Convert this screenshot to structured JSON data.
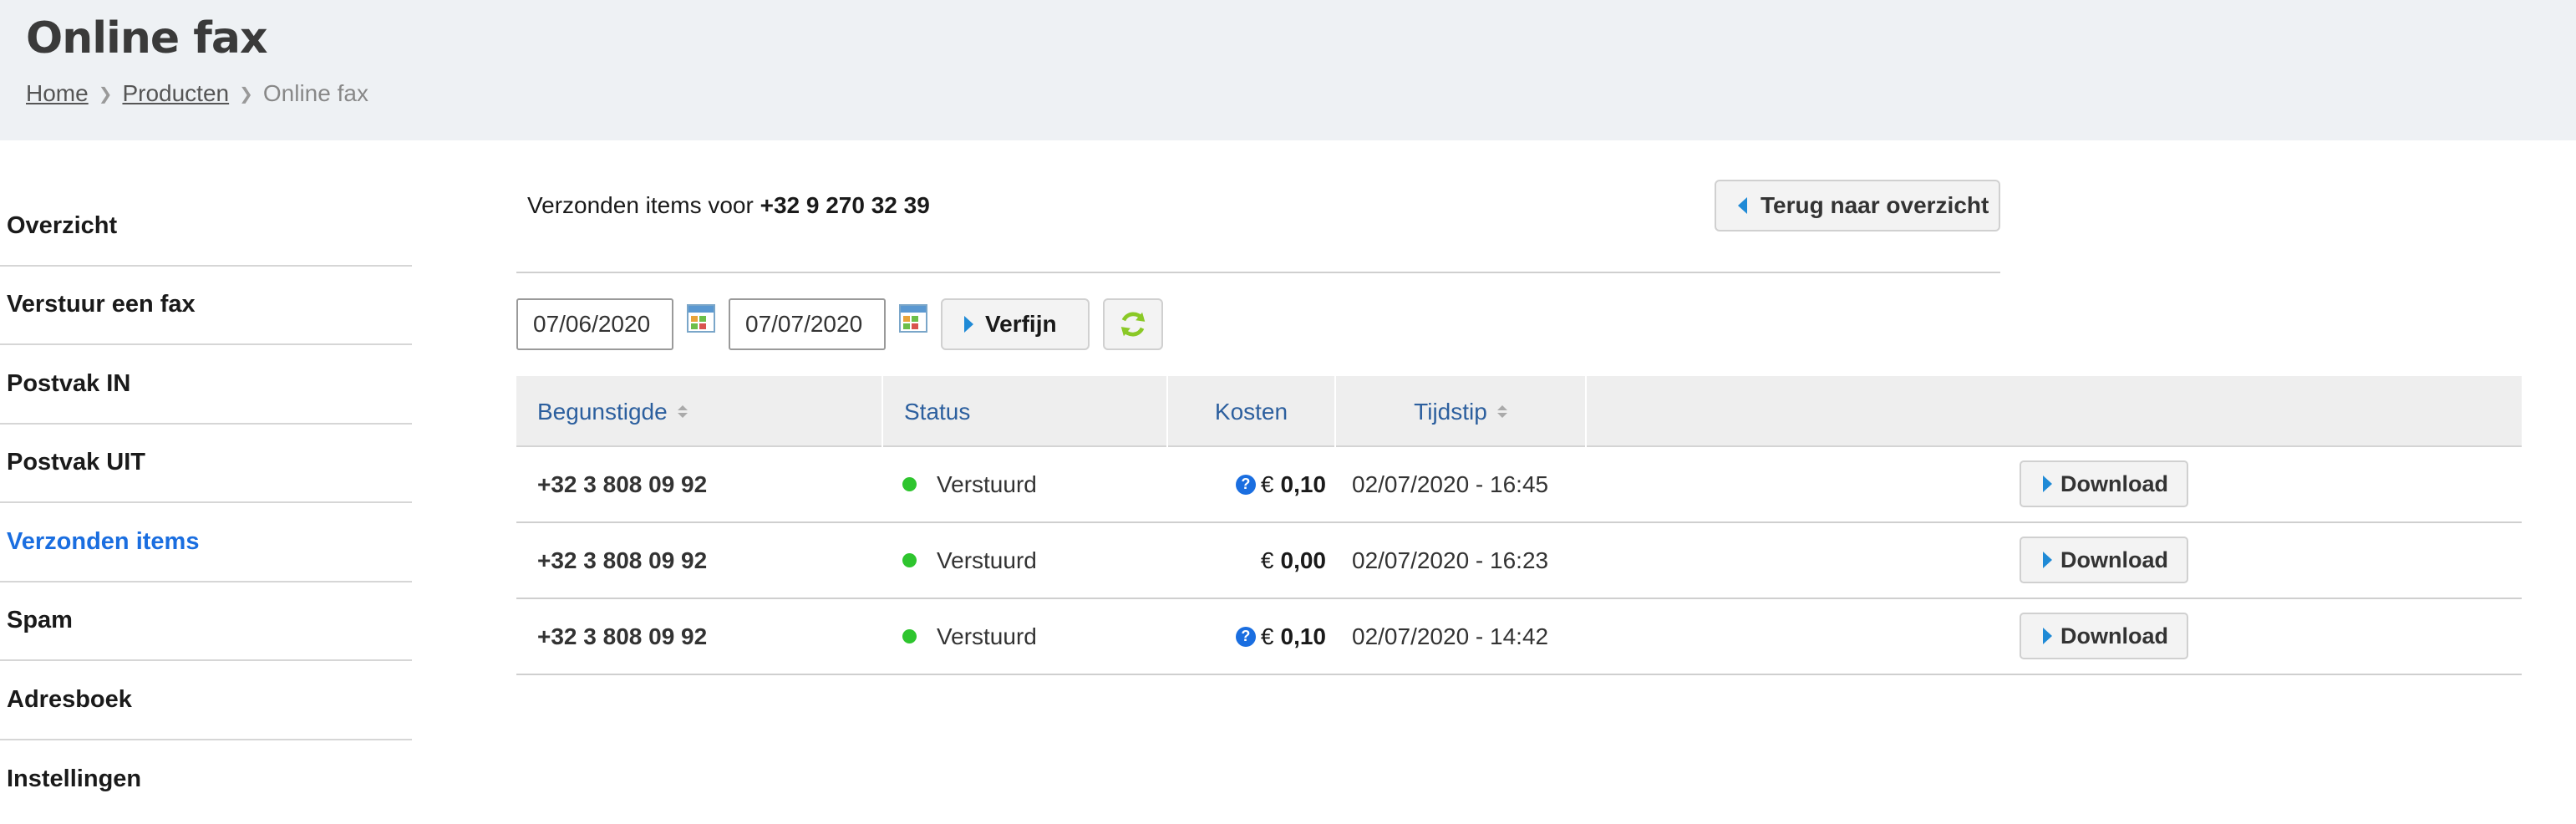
{
  "header": {
    "title": "Online fax",
    "breadcrumb": [
      {
        "label": "Home"
      },
      {
        "label": "Producten"
      },
      {
        "label": "Online fax"
      }
    ]
  },
  "sidebar": {
    "items": [
      {
        "label": "Overzicht"
      },
      {
        "label": "Verstuur een fax"
      },
      {
        "label": "Postvak IN"
      },
      {
        "label": "Postvak UIT"
      },
      {
        "label": "Verzonden items",
        "active": true
      },
      {
        "label": "Spam"
      },
      {
        "label": "Adresboek"
      },
      {
        "label": "Instellingen"
      }
    ]
  },
  "main": {
    "sent_prefix": "Verzonden items voor",
    "sent_number": "+32 9 270 32 39",
    "back_label": "Terug naar overzicht"
  },
  "filter": {
    "date_from": "07/06/2020",
    "date_to": "07/07/2020",
    "refine_label": "Verfijn"
  },
  "table": {
    "headers": {
      "recipient": "Begunstigde",
      "status": "Status",
      "cost": "Kosten",
      "time": "Tijdstip"
    },
    "rows": [
      {
        "recipient": "+32 3 808 09 92",
        "status": "Verstuurd",
        "currency": "€",
        "cost": "0,10",
        "help": true,
        "time": "02/07/2020 - 16:45",
        "action": "Download"
      },
      {
        "recipient": "+32 3 808 09 92",
        "status": "Verstuurd",
        "currency": "€",
        "cost": "0,00",
        "help": false,
        "time": "02/07/2020 - 16:23",
        "action": "Download"
      },
      {
        "recipient": "+32 3 808 09 92",
        "status": "Verstuurd",
        "currency": "€",
        "cost": "0,10",
        "help": true,
        "time": "02/07/2020 - 14:42",
        "action": "Download"
      }
    ]
  },
  "colors": {
    "accent": "#1a6ee0",
    "status_ok": "#2ec52e",
    "header_bg": "#eef1f4",
    "link_blue": "#2c5f9e"
  }
}
